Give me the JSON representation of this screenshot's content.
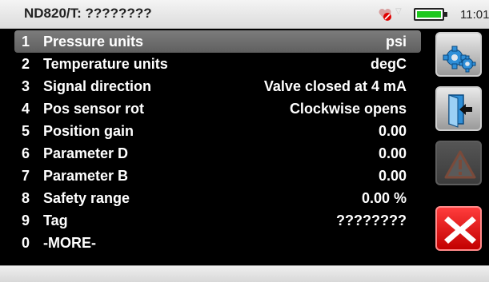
{
  "header": {
    "title": "ND820/T: ????????",
    "clock": "11:01"
  },
  "params": [
    {
      "num": "1",
      "label": "Pressure units",
      "value": "psi",
      "selected": true
    },
    {
      "num": "2",
      "label": "Temperature units",
      "value": "degC"
    },
    {
      "num": "3",
      "label": "Signal direction",
      "value": "Valve closed at 4 mA"
    },
    {
      "num": "4",
      "label": "Pos sensor rot",
      "value": "Clockwise opens"
    },
    {
      "num": "5",
      "label": "Position gain",
      "value": "0.00"
    },
    {
      "num": "6",
      "label": "Parameter D",
      "value": "0.00"
    },
    {
      "num": "7",
      "label": "Parameter B",
      "value": "0.00"
    },
    {
      "num": "8",
      "label": "Safety range",
      "value": "0.00 %"
    },
    {
      "num": "9",
      "label": "Tag",
      "value": "????????"
    },
    {
      "num": "0",
      "label": "-MORE-",
      "value": ""
    }
  ],
  "side_buttons": [
    {
      "icon": "settings-gears-icon",
      "color": "#9a9a9a"
    },
    {
      "icon": "exit-door-arrow-icon",
      "color": "#9a9a9a"
    },
    {
      "icon": "warning-triangle-icon",
      "color": "#444444"
    },
    {
      "icon": "close-x-icon",
      "color": "#e00000"
    }
  ]
}
